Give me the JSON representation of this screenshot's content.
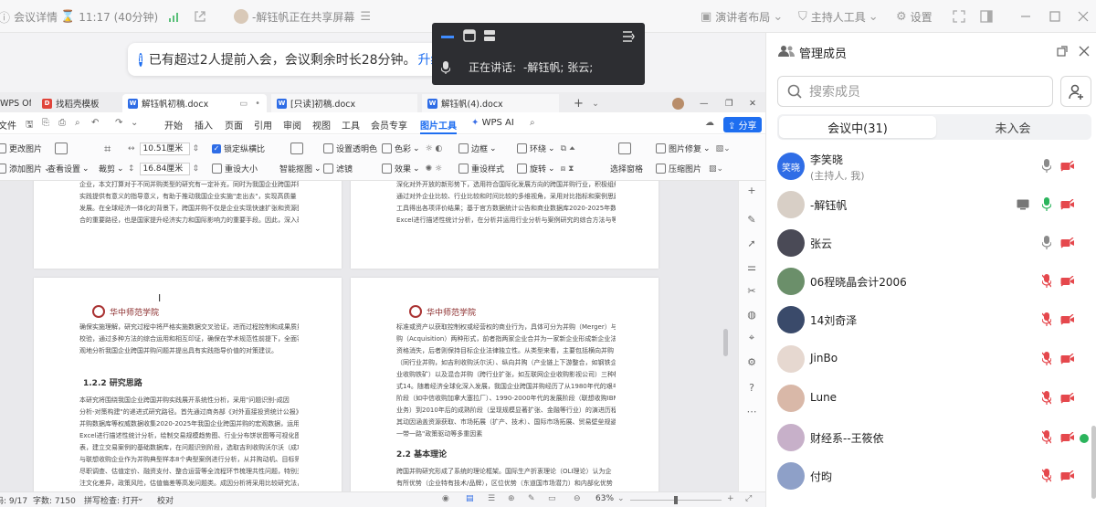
{
  "topbar": {
    "meeting_details": "会议详情",
    "time": "11:17 (40分钟)",
    "sharing_text": "-解钰帆正在共享屏幕",
    "presenter_layout": "演讲者布局",
    "host_tools": "主持人工具",
    "settings": "设置"
  },
  "notice": {
    "text": "已有超过2人提前入会，会议剩余时长28分钟。",
    "link": "升级"
  },
  "speaker": {
    "label": "正在讲话:",
    "names": "-解钰帆; 张云;"
  },
  "wps": {
    "tabs": [
      {
        "label": "WPS Office"
      },
      {
        "label": "找稻壳模板"
      },
      {
        "label": "解钰帆初稿.docx"
      },
      {
        "label": "[只读]初稿.docx"
      },
      {
        "label": "解钰帆(4).docx"
      }
    ],
    "menu": {
      "file": "文件",
      "items": [
        "开始",
        "插入",
        "页面",
        "引用",
        "审阅",
        "视图",
        "工具",
        "会员专享",
        "图片工具",
        "WPS AI"
      ],
      "share": "分享"
    },
    "ribbon": {
      "change_picture": "更改图片",
      "add_picture": "添加图片",
      "view_settings": "查看设置",
      "crop": "裁剪",
      "width_value": "10.51厘米",
      "height_value": "16.84厘米",
      "lock_ratio": "锁定纵横比",
      "reset_size": "重设大小",
      "smart_cutout": "智能抠图",
      "set_transparent": "设置透明色",
      "filter": "滤镜",
      "color": "色彩",
      "effects": "效果",
      "border": "边框",
      "reset_style": "重设样式",
      "wrap": "环绕",
      "rotate": "旋转",
      "selection_pane": "选择窗格",
      "picture_repair": "图片修复",
      "compress_picture": "压缩图片"
    },
    "pages": {
      "p1_lines": [
        "企业，本文打算对于不同并购类型的研究有一定补充，同时为我国企业跨国并购的分析理论",
        "实践提供有意义的指导意义，有助于推动我国企业实施\"走出去\"，实现高质量",
        "发展。在全球经济一体化的背景下，跨国并购不仅是企业实现快速扩张和资源整",
        "合的重要路径，也是国家提升经济实力和国际影响力的重要手段。因此，深入研"
      ],
      "p2_lines": [
        "深化对外开放的新形势下，选用符合国际化发展方向的跨国并购行业，积极组织研究行业案例",
        "通过对外企业比较、行业比较和时间比较的多维视角，采用对比指标和案例思路",
        "工具得出各项评价结果；基于官方数据统计公告和商业数据库2020-2025年数据，运用",
        "Excel进行描述性统计分析，在分析并运用行业分析与案例研究的综合方法与等要"
      ],
      "p3_lines": [
        "确保实施理解，研究过程中将严格实施数据交叉验证，进而过程控制和成果质量",
        "校验，通过多种方法的综合运用和相互印证，确保在学术规范性前提下，全面客",
        "观地分析我国企业跨国并购问题并提出具有实践指导价值的对策建议。"
      ],
      "p3_heading": "1.2.2 研究思路",
      "p3_lines2": [
        "本研究将围绕我国企业跨国并购实践展开系统性分析，采用\"问题识别-成因",
        "分析-对策构建\"的递进式研究路径。首先通过商务部《对外直接投资统计公报》",
        "并购数据库等权威数据收集2020-2025年我国企业跨国并购的宏观数据，运用",
        "Excel进行描述性统计分析，绘制交易规模趋势图、行业分布饼状图等可视化图",
        "表，建立交易案例的基础数据库，在问题识别阶段，选取吉利收购沃尔沃（成功）",
        "与联想收购企业作为并购典型样本8个典型案例进行分析，从并购动机、目标筛选、",
        "尽职调查、估值定价、融资支付、整合运营等全流程环节梳理共性问题，特别关",
        "注文化差异，政策风险，估值偏差等高发问题类。成因分析将采用比较研究法，"
      ],
      "p4_lines": [
        "标准或资产以获取控制权或经营权的商业行为，具体可分为并购（Merger）与收",
        "购（Acquisition）两种形式，前者指两家企业合并为一家新企业形成新企业法人",
        "资格消失，后者则保持目标企业法律独立性。从类型来看，主要包括横向并购",
        "（同行业并购，如吉利收购沃尔沃）、纵向并购（产业链上下游整合，如钢铁企",
        "业收购铁矿）以及混合并购（跨行业扩张，如互联网企业收购影视公司）三种模",
        "式14。随着经济全球化深入发展，我国企业跨国并购经历了从1980年代的艰辛",
        "阶段（如中信收购加拿大塞拉厂）、1990-2000年代的发展阶段（联想收购IBM PC",
        "业务）到2010年后的成熟阶段（呈现规模显著扩张、金融等行业）的演进历程，",
        "其动因涵盖资源获取、市场拓展（扩产、技术）、国际市场拓展、贸易壁垒规避以及\"",
        "一带一路\"政策驱动等多重因素"
      ],
      "p4_heading": "2.2 基本理论",
      "p4_lines2": [
        "跨国并购研究形成了系统的理论框架。国际生产折衷理论（OLI理论）认为企",
        "有所优势（企业特有技术/品牌），区位优势（东道国市场潜力）和内部化优势"
      ]
    },
    "status": {
      "page": "页码: 9/17",
      "words": "字数: 7150",
      "spell": "拼写检查: 打开",
      "proof": "校对",
      "zoom": "63%"
    }
  },
  "panel": {
    "title": "管理成员",
    "search_placeholder": "搜索成员",
    "tab_in": "会议中(31)",
    "tab_out": "未入会",
    "members": [
      {
        "name": "李笑晓",
        "sub": "(主持人, 我)",
        "avatar_text": "笑晓",
        "mic": "on",
        "cam": "off",
        "screen": false
      },
      {
        "name": "-解钰帆",
        "sub": "",
        "avatar_text": "",
        "mic": "active",
        "cam": "off",
        "screen": true
      },
      {
        "name": "张云",
        "sub": "",
        "avatar_text": "",
        "mic": "on",
        "cam": "off",
        "screen": false
      },
      {
        "name": "06程晓晶会计2006",
        "sub": "",
        "avatar_text": "",
        "mic": "muted",
        "cam": "off",
        "screen": false
      },
      {
        "name": "14刘奇泽",
        "sub": "",
        "avatar_text": "",
        "mic": "muted",
        "cam": "off",
        "screen": false
      },
      {
        "name": "JinBo",
        "sub": "",
        "avatar_text": "",
        "mic": "muted",
        "cam": "off",
        "screen": false
      },
      {
        "name": "Lune",
        "sub": "",
        "avatar_text": "",
        "mic": "muted",
        "cam": "off",
        "screen": false
      },
      {
        "name": "财经系--王筱依",
        "sub": "",
        "avatar_text": "",
        "mic": "muted",
        "cam": "off",
        "screen": false
      },
      {
        "name": "付昀",
        "sub": "",
        "avatar_text": "",
        "mic": "muted",
        "cam": "off",
        "screen": false
      }
    ]
  },
  "colors": {
    "accent": "#1e6ef0",
    "mic_active": "#2bb45c",
    "muted_red": "#e5484d"
  }
}
